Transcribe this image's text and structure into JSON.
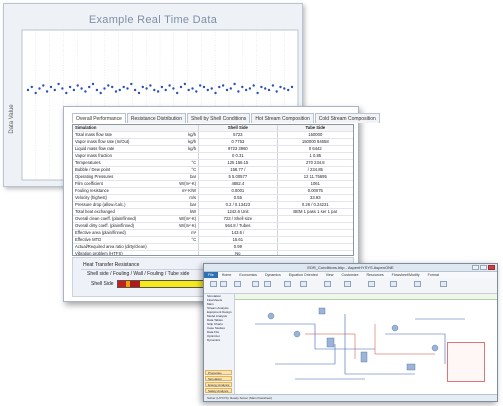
{
  "chart_window": {
    "title": "Example Real Time Data",
    "ylabel": "Data Value",
    "series_color": "#2952b3",
    "grid_color": "#c9d3e0"
  },
  "chart_data": {
    "type": "scatter",
    "title": "Example Real Time Data",
    "xlabel": "",
    "ylabel": "Data Value",
    "grid": true,
    "ylim": [
      0,
      100
    ],
    "x": [
      1,
      2,
      3,
      4,
      5,
      6,
      7,
      8,
      9,
      10,
      11,
      12,
      13,
      14,
      15,
      16,
      17,
      18,
      19,
      20,
      21,
      22,
      23,
      24,
      25,
      26,
      27,
      28,
      29,
      30,
      31,
      32,
      33,
      34,
      35,
      36,
      37,
      38,
      39,
      40,
      41,
      42,
      43,
      44,
      45,
      46,
      47,
      48,
      49,
      50,
      51,
      52,
      53,
      54,
      55,
      56,
      57,
      58,
      59,
      60,
      61,
      62,
      63,
      64,
      65,
      66,
      67,
      68,
      69,
      70
    ],
    "values": [
      60,
      62,
      58,
      61,
      63,
      59,
      62,
      60,
      64,
      61,
      58,
      62,
      60,
      63,
      61,
      59,
      62,
      64,
      60,
      58,
      61,
      63,
      62,
      59,
      60,
      62,
      61,
      64,
      60,
      58,
      62,
      61,
      63,
      60,
      59,
      62,
      60,
      63,
      61,
      58,
      62,
      64,
      60,
      61,
      59,
      63,
      62,
      60,
      61,
      58,
      62,
      63,
      60,
      61,
      64,
      59,
      62,
      60,
      61,
      63,
      58,
      62,
      61,
      60,
      63,
      59,
      62,
      61,
      60,
      62
    ]
  },
  "performance_window": {
    "tabs": [
      "Overall Performance",
      "Resistance Distribution",
      "Shell by Shell Conditions",
      "Hot Stream Composition",
      "Cold Stream Composition"
    ],
    "header": {
      "label": "Simulation",
      "unit": "",
      "shell": "Shell Side",
      "tube": "Tube Side"
    },
    "rows": [
      {
        "label": "Total mass flow rate",
        "unit": "kg/h",
        "shell": "5723",
        "tube": "150000"
      },
      {
        "label": "Vapor mass flow rate (In/Out)",
        "unit": "kg/h",
        "shell": "0       7753",
        "tube": "150000    84658"
      },
      {
        "label": "Liquid mass flow rate",
        "unit": "kg/h",
        "shell": "9723    3960",
        "tube": "0       6442"
      },
      {
        "label": "Vapor mass fraction",
        "unit": "",
        "shell": "0       0.31",
        "tube": "1       0.85"
      },
      {
        "label": "Temperatures",
        "unit": "°C",
        "shell": "125     158.15",
        "tube": "270     234.8"
      },
      {
        "label": "Bubble / Dew point",
        "unit": "°C",
        "shell": "158.77  /",
        "tube": "/  234.85"
      },
      {
        "label": "Operating Pressures",
        "unit": "bar",
        "shell": "5       5.00577",
        "tube": "12      11.75695"
      },
      {
        "label": "Film coefficient",
        "unit": "W/(m²·K)",
        "shell": "4882.4",
        "tube": "1061"
      },
      {
        "label": "Fouling resistance",
        "unit": "m²·K/W",
        "shell": "0.0001",
        "tube": "0.00075"
      },
      {
        "label": "Velocity (highest)",
        "unit": "m/s",
        "shell": "0.55",
        "tube": "33.93"
      },
      {
        "label": "Pressure drop (allow./calc.)",
        "unit": "bar",
        "shell": "0.2   /   0.13423",
        "tube": "0.26   /   0.24231"
      },
      {
        "label": "Total heat exchanged",
        "unit": "kW",
        "shell": "1242.6      Unit",
        "tube": "BEM    1 pass   1 ser   1 par"
      },
      {
        "label": "Overall clean coeff. (plain/finned)",
        "unit": "W/(m²·K)",
        "shell": "723  /      Shell size",
        "tube": ""
      },
      {
        "label": "Overall dirty coeff. (plain/finned)",
        "unit": "W/(m²·K)",
        "shell": "564.8  /     Tubes",
        "tube": ""
      },
      {
        "label": "Effective area (plain/finned)",
        "unit": "m²",
        "shell": "143.6  /",
        "tube": ""
      },
      {
        "label": "Effective MTD",
        "unit": "°C",
        "shell": "15.61",
        "tube": ""
      },
      {
        "label": "Actual/Required area ratio (dirty/clean)",
        "unit": "",
        "shell": "0.99",
        "tube": ""
      },
      {
        "label": "Vibration problem (HTFS)",
        "unit": "",
        "shell": "No",
        "tube": ""
      },
      {
        "label": "RhoV2 problem",
        "unit": "",
        "shell": "No",
        "tube": ""
      }
    ],
    "resistance": {
      "title": "Heat Transfer Resistance",
      "subtitle": "Shell side / Fouling / Wall / Fouling / Tube side",
      "bar_label": "Shell Side",
      "shell_film_fraction": 0.12,
      "shell_fouling_fraction": 0.05,
      "wall_fraction": 0.03,
      "tube_fouling_fraction": 0.05,
      "tube_film_fraction": 0.75
    }
  },
  "app_window": {
    "title": "EDR_Conditions.bkp - AspenHYSYS  AspenONE",
    "ribbon_tabs": [
      "File",
      "Home",
      "Economics",
      "Dynamics",
      "Equation Oriented",
      "View",
      "Customize",
      "Resources",
      "Flowsheet/Modify",
      "Format"
    ],
    "sidebar_items": [
      "Simulation",
      "Flowsheets",
      "Main",
      "Stream Analysis",
      "Equipment Design",
      "Model Analysis",
      "Data Tables",
      "Strip Charts",
      "Case Studies",
      "Data Fits",
      "Optimizer",
      "Dynamics"
    ],
    "sidebar_blocks": [
      "Properties",
      "Simulation",
      "Energy Analysis",
      "Safety Analysis"
    ],
    "status": "Solver (HYSYS): Ready  Solver (Main Flowsheet)"
  }
}
